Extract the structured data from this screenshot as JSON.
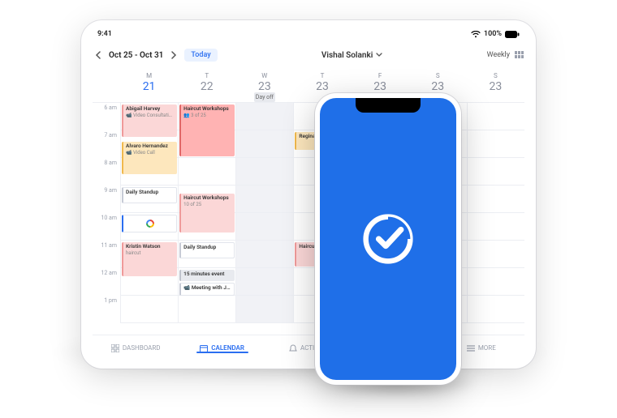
{
  "status": {
    "time": "9:41",
    "wifi": "wifi-icon",
    "battery_pct": "100%"
  },
  "header": {
    "date_range": "Oct 25 - Oct 31",
    "today_label": "Today",
    "user_name": "Vishal Solanki",
    "view_label": "Weekly"
  },
  "days": [
    {
      "short": "M",
      "num": "21",
      "active": true
    },
    {
      "short": "T",
      "num": "22",
      "active": false
    },
    {
      "short": "W",
      "num": "23",
      "active": false,
      "dayoff": "Day off"
    },
    {
      "short": "T",
      "num": "23",
      "active": false
    },
    {
      "short": "F",
      "num": "23",
      "active": false
    },
    {
      "short": "S",
      "num": "23",
      "active": false
    },
    {
      "short": "S",
      "num": "23",
      "active": false
    }
  ],
  "times": [
    "6 am",
    "7 am",
    "8 am",
    "9 am",
    "10 am",
    "11 am",
    "12 am",
    "1 pm"
  ],
  "events": {
    "e1": {
      "title": "Abigail Harvey",
      "sub": "📹 Video Consultations"
    },
    "e2": {
      "title": "Haircut Workshops",
      "sub": "👥 3 of 25"
    },
    "e3": {
      "title": "Alvaro Hernandez",
      "sub": "📹 Video Call"
    },
    "e4": {
      "title": "Daily Standup",
      "sub": ""
    },
    "e5": {
      "title": "Haircut Workshops",
      "sub": "10 of 25"
    },
    "e6": {
      "title": "Kristin Watson",
      "sub": "haircut"
    },
    "e7": {
      "title": "Daily Standup",
      "sub": ""
    },
    "e8": {
      "title": "15 minutes event",
      "sub": ""
    },
    "e9": {
      "title": "📹 Meeting with Jo…",
      "sub": ""
    },
    "e10": {
      "title": "Regina",
      "sub": ""
    },
    "e11": {
      "title": "Haircut",
      "sub": ""
    }
  },
  "tabs": {
    "dashboard": "DASHBOARD",
    "calendar": "CALENDAR",
    "activity": "ACTIVITY",
    "blank": "",
    "more": "MORE"
  }
}
